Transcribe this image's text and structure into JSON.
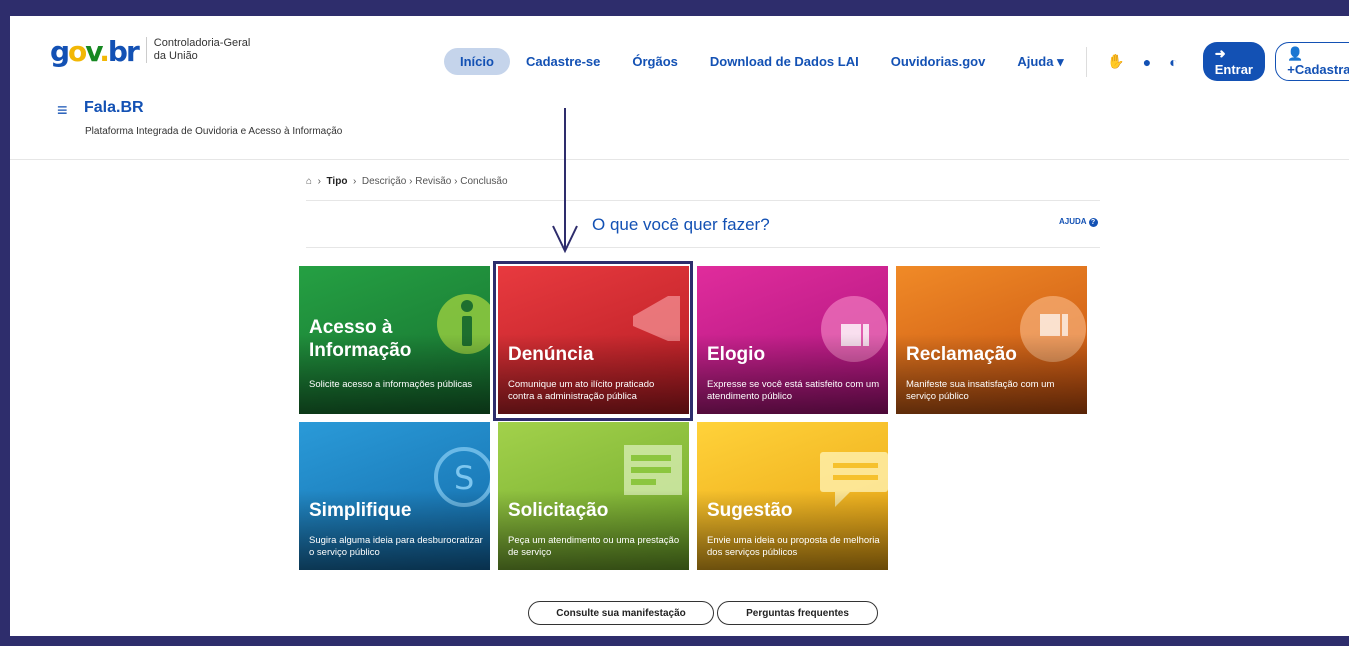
{
  "header": {
    "logo": {
      "g": "g",
      "o": "o",
      "v": "v",
      "dot": ".",
      "br": "br"
    },
    "org_line1": "Controladoria-Geral",
    "org_line2": "da União",
    "nav": [
      "Início",
      "Cadastre-se",
      "Órgãos",
      "Download de Dados LAI",
      "Ouvidorias.gov",
      "Ajuda ▾"
    ],
    "entrar": "Entrar",
    "cadastrar": "Cadastrar"
  },
  "system": {
    "title": "Fala.BR",
    "subtitle": "Plataforma Integrada de Ouvidoria e Acesso à Informação"
  },
  "breadcrumb": {
    "current": "Tipo",
    "steps": "Descrição  ›  Revisão  ›  Conclusão"
  },
  "question": "O que você quer fazer?",
  "help": "AJUDA",
  "cards": [
    {
      "title": "Acesso à Informação",
      "desc": "Solicite acesso a informações públicas",
      "color": "#1e8a3c",
      "icon": "info-icon"
    },
    {
      "title": "Denúncia",
      "desc": "Comunique um ato ilícito praticado contra a administração pública",
      "color": "#d9242b",
      "icon": "megaphone-icon"
    },
    {
      "title": "Elogio",
      "desc": "Expresse se você está satisfeito com um atendimento público",
      "color": "#d41e8c",
      "icon": "thumbs-up-icon"
    },
    {
      "title": "Reclamação",
      "desc": "Manifeste sua insatisfação com um serviço público",
      "color": "#e8661e",
      "icon": "thumbs-down-icon"
    },
    {
      "title": "Simplifique",
      "desc": "Sugira alguma ideia para desburocratizar o serviço público",
      "color": "#1b86c8",
      "icon": "simplifique-icon"
    },
    {
      "title": "Solicitação",
      "desc": "Peça um atendimento ou uma prestação de serviço",
      "color": "#8cc63f",
      "icon": "form-click-icon"
    },
    {
      "title": "Sugestão",
      "desc": "Envie uma ideia ou proposta de melhoria dos serviços públicos",
      "color": "#f6b71d",
      "icon": "speech-bubble-icon"
    }
  ],
  "footer_buttons": [
    "Consulte sua manifestação",
    "Perguntas frequentes"
  ]
}
